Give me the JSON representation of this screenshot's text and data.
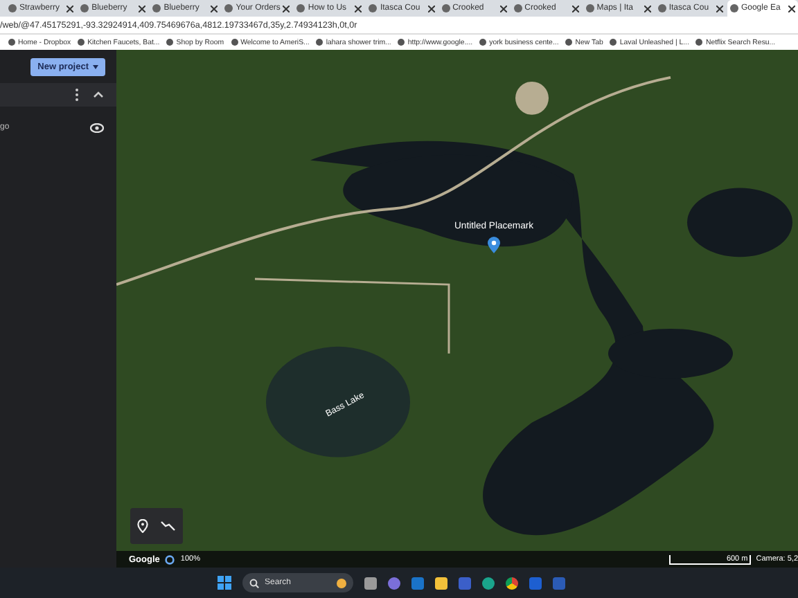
{
  "tabs": [
    {
      "label": "Strawberry",
      "selected": false
    },
    {
      "label": "Blueberry",
      "selected": false
    },
    {
      "label": "Blueberry",
      "selected": false
    },
    {
      "label": "Your Orders",
      "selected": false
    },
    {
      "label": "How to Us",
      "selected": false
    },
    {
      "label": "Itasca Cou",
      "selected": false
    },
    {
      "label": "Crooked",
      "selected": false
    },
    {
      "label": "Crooked",
      "selected": false
    },
    {
      "label": "Maps | Ita",
      "selected": false
    },
    {
      "label": "Itasca Cou",
      "selected": false
    },
    {
      "label": "Google Ea",
      "selected": true
    }
  ],
  "address": "/web/@47.45175291,-93.32924914,409.75469676a,4812.19733467d,35y,2.74934123h,0t,0r",
  "bookmarks": [
    "Home - Dropbox",
    "Kitchen Faucets, Bat...",
    "Shop by Room",
    "Welcome to AmeriS...",
    "lahara shower trim...",
    "http://www.google....",
    "york business cente...",
    "New Tab",
    "Laval Unleashed | L...",
    "Netflix Search Resu..."
  ],
  "sidebar": {
    "new_project": "New project",
    "item_text": "go"
  },
  "map": {
    "placemark": "Untitled Placemark",
    "lake_label": "Bass Lake"
  },
  "status_bar": {
    "logo": "Google",
    "zoom": "100%",
    "scale": "600 m",
    "camera": "Camera: 5,2"
  },
  "taskbar": {
    "search": {
      "placeholder": "Search"
    }
  }
}
